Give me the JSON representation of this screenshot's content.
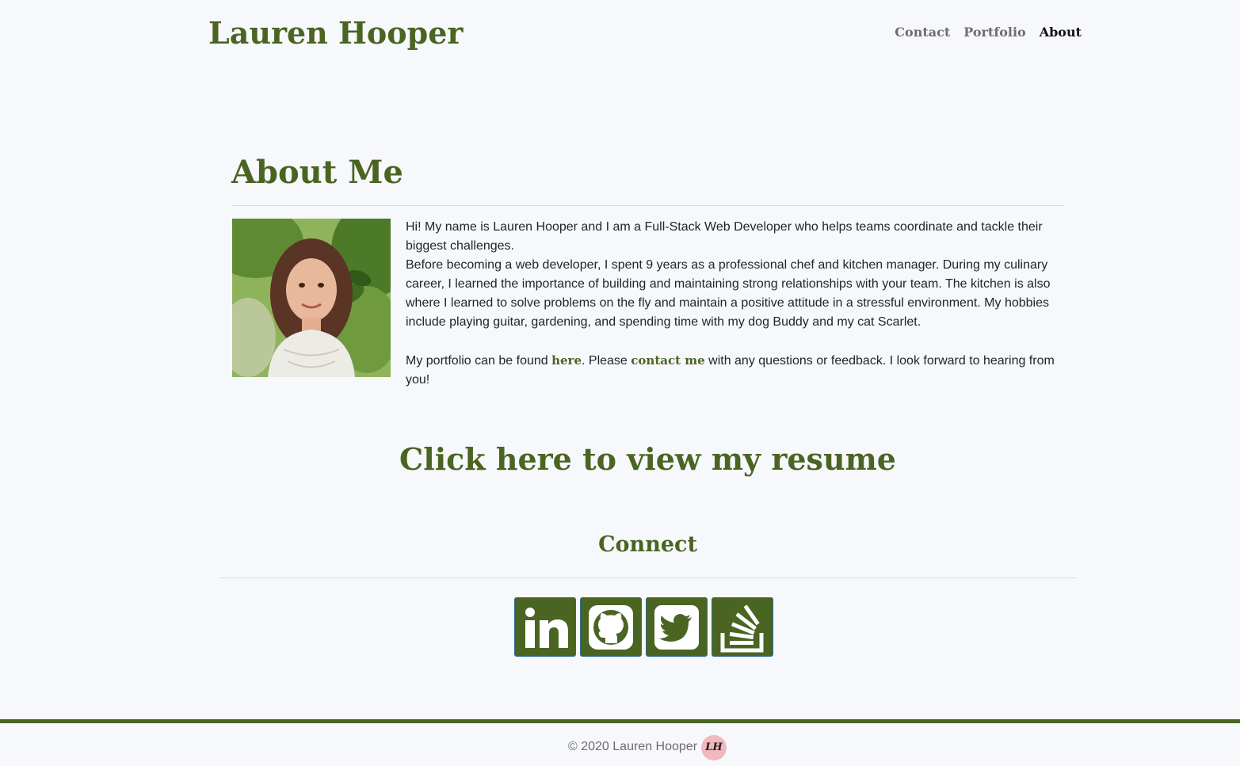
{
  "header": {
    "brand": "Lauren Hooper",
    "nav": [
      {
        "label": "Contact"
      },
      {
        "label": "Portfolio"
      },
      {
        "label": "About"
      }
    ]
  },
  "about": {
    "title": "About Me",
    "para1": "Hi! My name is Lauren Hooper and I am a Full-Stack Web Developer who helps teams coordinate and tackle their biggest challenges.",
    "para2": "Before becoming a web developer, I spent 9 years as a professional chef and kitchen manager. During my culinary career, I learned the importance of building and maintaining strong relationships with your team. The kitchen is also where I learned to solve problems on the fly and maintain a positive attitude in a stressful environment. My hobbies include playing guitar, gardening, and spending time with my dog Buddy and my cat Scarlet.",
    "para3_before": "My portfolio can be found ",
    "portfolio_link": "here",
    "para3_middle": ". Please ",
    "contact_link": "contact me",
    "para3_after": " with any questions or feedback. I look forward to hearing from you!"
  },
  "resume": {
    "label": "Click here to view my resume"
  },
  "connect": {
    "title": "Connect",
    "links": [
      {
        "icon": "linkedin-icon"
      },
      {
        "icon": "github-icon"
      },
      {
        "icon": "twitter-icon"
      },
      {
        "icon": "stackoverflow-icon"
      }
    ]
  },
  "footer": {
    "copyright": "© 2020 Lauren Hooper",
    "logo_text": "LH"
  },
  "colors": {
    "accent": "#4a6422",
    "background": "#f7f8fc",
    "logo_bg": "#efb9bf"
  }
}
